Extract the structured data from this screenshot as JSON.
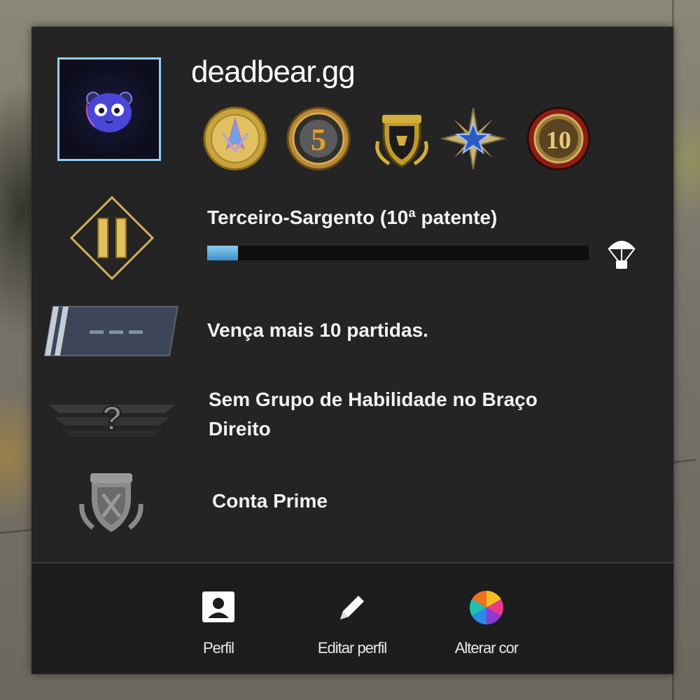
{
  "profile": {
    "username": "deadbear.gg"
  },
  "rank": {
    "title": "Terceiro-Sargento (10ª patente)",
    "progress_percent": 8
  },
  "competitive": {
    "label": "Vença mais 10 partidas."
  },
  "skill_group": {
    "label_line1": "Sem Grupo de Habilidade no Braço",
    "label_line2": "Direito"
  },
  "prime": {
    "label": "Conta Prime"
  },
  "footer": {
    "profile_label": "Perfil",
    "edit_label": "Editar perfil",
    "color_label": "Alterar cor"
  },
  "medals": {
    "service_medal_number": "5",
    "years_coin_number": "10"
  },
  "colors": {
    "panel_bg": "#242424",
    "footer_bg": "#1d1d1d",
    "avatar_border": "#8fd0f6",
    "progress_fill": "#3f8fca",
    "progress_track": "#0e0e0e",
    "text": "#f2f2f2"
  },
  "icons": {
    "rank": "rank-chevron-icon",
    "competitive": "competitive-rank-icon",
    "skill_group": "skill-group-unknown-icon",
    "prime": "prime-badge-icon",
    "drop": "parachute-icon",
    "profile": "profile-card-icon",
    "edit": "pencil-icon",
    "color": "color-wheel-icon"
  }
}
